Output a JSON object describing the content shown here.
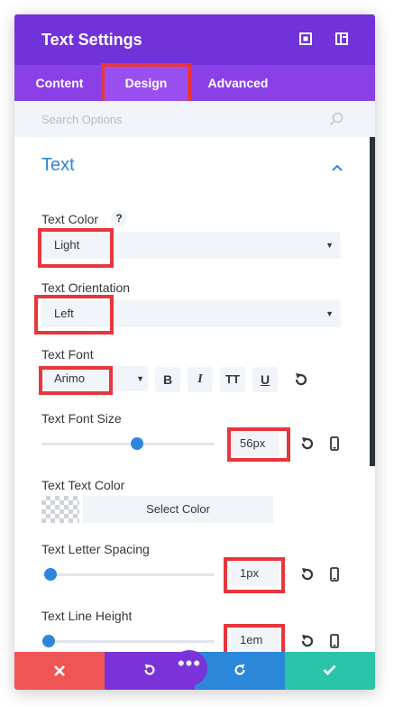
{
  "header": {
    "title": "Text Settings"
  },
  "tabs": [
    {
      "label": "Content"
    },
    {
      "label": "Design"
    },
    {
      "label": "Advanced"
    }
  ],
  "search": {
    "placeholder": "Search Options"
  },
  "section": {
    "title": "Text"
  },
  "fields": {
    "text_color": {
      "label": "Text Color",
      "help": "?",
      "value": "Light"
    },
    "text_orientation": {
      "label": "Text Orientation",
      "value": "Left"
    },
    "text_font": {
      "label": "Text Font",
      "value": "Arimo",
      "bold": "B",
      "italic": "I",
      "uppercase": "TT",
      "underline": "U"
    },
    "text_font_size": {
      "label": "Text Font Size",
      "value": "56px",
      "slider_level": 0.56
    },
    "text_text_color": {
      "label": "Text Text Color",
      "button": "Select Color"
    },
    "text_letter_spacing": {
      "label": "Text Letter Spacing",
      "value": "1px",
      "slider_level": 0.0
    },
    "text_line_height": {
      "label": "Text Line Height",
      "value": "1em",
      "slider_level": 0.0
    }
  },
  "footer": {
    "more": "•••"
  },
  "colors": {
    "header": "#7232d9",
    "tabs": "#8a40e6",
    "accent": "#2e86db",
    "highlight": "#e8363d",
    "cancel": "#ef5555",
    "undo": "#7a33d9",
    "redo": "#2b87da",
    "save": "#29c4a9"
  }
}
